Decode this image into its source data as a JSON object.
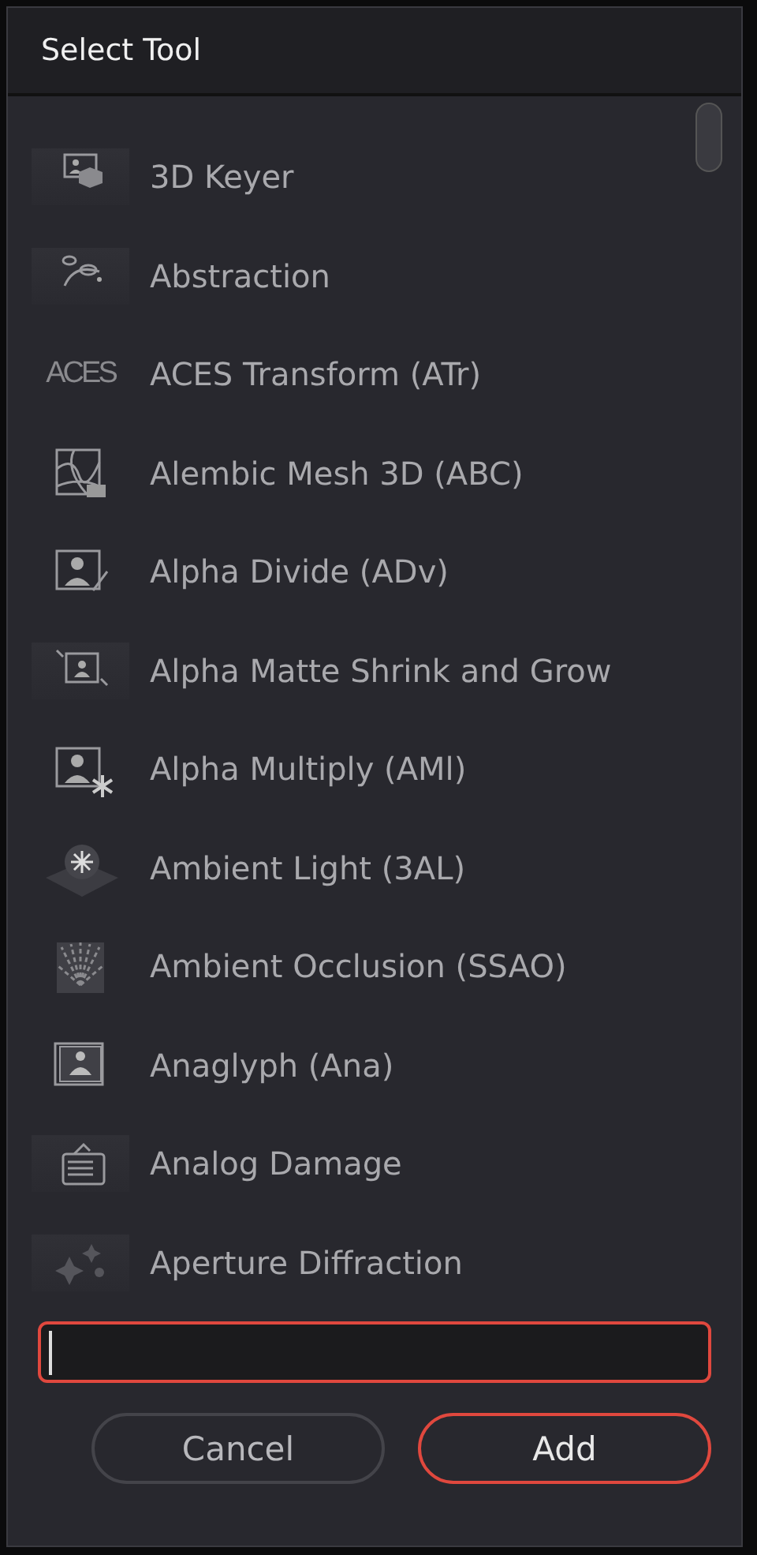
{
  "dialog": {
    "title": "Select Tool"
  },
  "tools": [
    {
      "label": "3D Keyer"
    },
    {
      "label": "Abstraction"
    },
    {
      "label": "ACES Transform (ATr)",
      "logo": "ACES"
    },
    {
      "label": "Alembic Mesh 3D (ABC)"
    },
    {
      "label": "Alpha Divide (ADv)"
    },
    {
      "label": "Alpha Matte Shrink and Grow"
    },
    {
      "label": "Alpha Multiply (AMl)"
    },
    {
      "label": "Ambient Light (3AL)"
    },
    {
      "label": "Ambient Occlusion (SSAO)"
    },
    {
      "label": "Anaglyph (Ana)"
    },
    {
      "label": "Analog Damage"
    },
    {
      "label": "Aperture Diffraction"
    }
  ],
  "search_field": {
    "focused": true
  },
  "buttons": [
    {
      "label": "Cancel",
      "primary": false
    },
    {
      "label": "Add",
      "primary": true
    }
  ]
}
